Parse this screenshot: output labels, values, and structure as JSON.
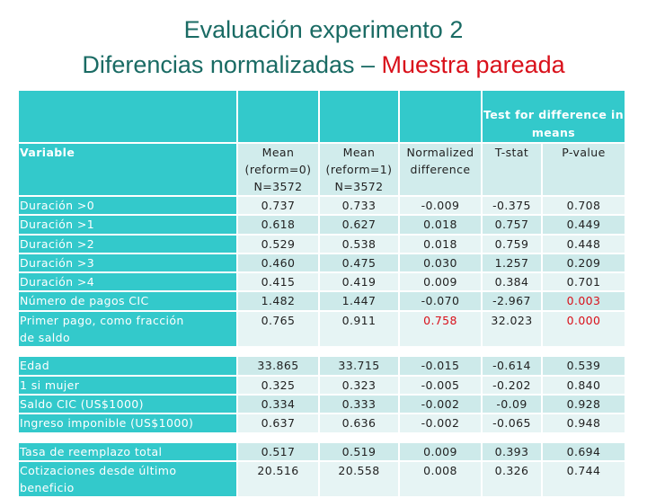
{
  "title": {
    "line1": "Evaluación experimento 2",
    "line2_prefix": "Diferencias normalizadas – ",
    "line2_accent": "Muestra pareada"
  },
  "colors": {
    "title": "#1a6b64",
    "accent": "#d9101a",
    "header": "#33c9cb",
    "cell_light": "#e6f4f4",
    "cell_dark": "#cdeaea"
  },
  "table": {
    "group_header": "Test for difference in means",
    "headers": {
      "variable": "Variable",
      "mean0": [
        "Mean",
        "(reform=0)",
        "N=3572"
      ],
      "mean1": [
        "Mean",
        "(reform=1)",
        "N=3572"
      ],
      "normdiff": [
        "Normalized",
        "difference"
      ],
      "tstat": "T-stat",
      "pvalue": "P-value"
    },
    "groups": [
      {
        "rows": [
          {
            "variable": "Duración >0",
            "mean0": "0.737",
            "mean1": "0.733",
            "normdiff": "-0.009",
            "tstat": "-0.375",
            "pvalue": "0.708"
          },
          {
            "variable": "Duración >1",
            "mean0": "0.618",
            "mean1": "0.627",
            "normdiff": "0.018",
            "tstat": "0.757",
            "pvalue": "0.449"
          },
          {
            "variable": "Duración >2",
            "mean0": "0.529",
            "mean1": "0.538",
            "normdiff": "0.018",
            "tstat": "0.759",
            "pvalue": "0.448"
          },
          {
            "variable": "Duración >3",
            "mean0": "0.460",
            "mean1": "0.475",
            "normdiff": "0.030",
            "tstat": "1.257",
            "pvalue": "0.209"
          },
          {
            "variable": "Duración >4",
            "mean0": "0.415",
            "mean1": "0.419",
            "normdiff": "0.009",
            "tstat": "0.384",
            "pvalue": "0.701"
          },
          {
            "variable": "Número de pagos CIC",
            "mean0": "1.482",
            "mean1": "1.447",
            "normdiff": "-0.070",
            "tstat": "-2.967",
            "pvalue": "0.003",
            "highlight": [
              "pvalue"
            ]
          },
          {
            "variable": "Primer pago, como fracción de saldo",
            "variable_lines": [
              "Primer pago, como fracción",
              "de saldo"
            ],
            "mean0": "0.765",
            "mean1": "0.911",
            "normdiff": "0.758",
            "tstat": "32.023",
            "pvalue": "0.000",
            "highlight": [
              "normdiff",
              "pvalue"
            ]
          }
        ]
      },
      {
        "rows": [
          {
            "variable": "Edad",
            "mean0": "33.865",
            "mean1": "33.715",
            "normdiff": "-0.015",
            "tstat": "-0.614",
            "pvalue": "0.539"
          },
          {
            "variable": "1 si mujer",
            "mean0": "0.325",
            "mean1": "0.323",
            "normdiff": "-0.005",
            "tstat": "-0.202",
            "pvalue": "0.840"
          },
          {
            "variable": "Saldo CIC (US$1000)",
            "mean0": "0.334",
            "mean1": "0.333",
            "normdiff": "-0.002",
            "tstat": "-0.09",
            "pvalue": "0.928"
          },
          {
            "variable": "Ingreso imponible (US$1000)",
            "mean0": "0.637",
            "mean1": "0.636",
            "normdiff": "-0.002",
            "tstat": "-0.065",
            "pvalue": "0.948"
          }
        ]
      },
      {
        "rows": [
          {
            "variable": "Tasa de reemplazo total",
            "mean0": "0.517",
            "mean1": "0.519",
            "normdiff": "0.009",
            "tstat": "0.393",
            "pvalue": "0.694"
          },
          {
            "variable": "Cotizaciones desde último beneficio",
            "variable_lines": [
              "Cotizaciones desde último",
              "beneficio"
            ],
            "mean0": "20.516",
            "mean1": "20.558",
            "normdiff": "0.008",
            "tstat": "0.326",
            "pvalue": "0.744"
          }
        ]
      }
    ]
  }
}
